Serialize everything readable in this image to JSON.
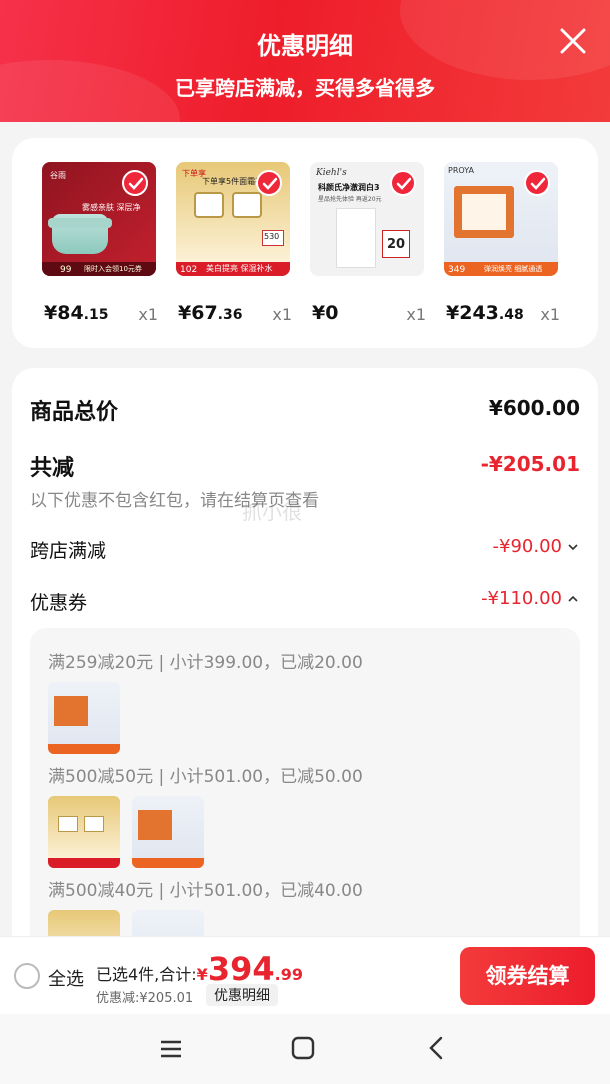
{
  "header": {
    "title": "优惠明细",
    "subtitle": "已享跨店满减，买得多省得多"
  },
  "products": [
    {
      "price_int": "¥84",
      "price_dec": ".15",
      "qty": "x1",
      "brand": "谷雨",
      "tag": "99",
      "tag2": "限时入会领10元券",
      "slogan": "雾感亲肤 深层净"
    },
    {
      "price_int": "¥67",
      "price_dec": ".36",
      "qty": "x1",
      "brand": "下单享",
      "tag": "102",
      "tag2": "美白提亮 保湿补水",
      "slogan": "下单享5件面霜礼",
      "num": "530"
    },
    {
      "price_int": "¥0",
      "price_dec": "",
      "qty": "x1",
      "brand": "Kiehl's",
      "tag": "20",
      "slogan": "科颜氏净澈润白3",
      "slogan2": "星品抢先体验 再返20元"
    },
    {
      "price_int": "¥243",
      "price_dec": ".48",
      "qty": "x1",
      "brand": "PROYA",
      "tag": "349",
      "tag2": "弹润焕亮 细腻通透"
    }
  ],
  "summary": {
    "total_label": "商品总价",
    "total_value": "¥600.00",
    "discount_label": "共减",
    "discount_value": "-¥205.01",
    "note": "以下优惠不包含红包，请在结算页查看",
    "cross_store_label": "跨店满减",
    "cross_store_value": "-¥90.00",
    "coupon_label": "优惠券",
    "coupon_value": "-¥110.00"
  },
  "coupons": [
    {
      "text": "满259减20元 | 小计399.00，已减20.00"
    },
    {
      "text": "满500减50元 | 小计501.00，已减50.00"
    },
    {
      "text": "满500减40元 | 小计501.00，已减40.00"
    }
  ],
  "watermark": "抓小很",
  "bottom": {
    "select_all": "全选",
    "selected_summary": "已选4件,合计:",
    "total_symbol": "¥",
    "total_int": "394",
    "total_dec": ".99",
    "discount_text": "优惠减:¥205.01",
    "detail_link": "优惠明细",
    "checkout": "领券结算"
  },
  "colors": {
    "accent": "#f0273b",
    "discount": "#e8242f"
  }
}
